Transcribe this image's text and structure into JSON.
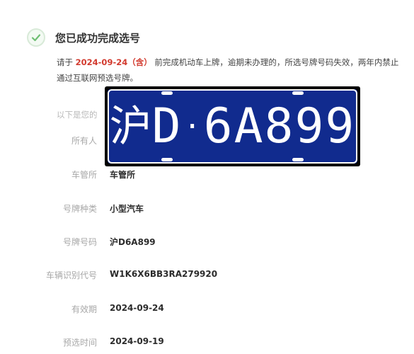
{
  "success": {
    "title": "您已成功完成选号",
    "check_color": "#6fbf73"
  },
  "notice": {
    "prefix": "请于",
    "deadline": "2024-09-24（含）",
    "suffix": "前完成机动车上牌，逾期未办理的，所选号牌号码失效，两年内禁止通过互联网预选号牌。"
  },
  "info_header": "以下是您的",
  "plate": {
    "province": "沪",
    "letter": "D",
    "dot": "·",
    "number": "6A899",
    "background_color": "#112b8e",
    "text_color": "#ffffff"
  },
  "fields": {
    "owner": {
      "label": "所有人",
      "value": ""
    },
    "office": {
      "label": "车管所",
      "value": "车管所"
    },
    "plate_type": {
      "label": "号牌种类",
      "value": "小型汽车"
    },
    "plate_number": {
      "label": "号牌号码",
      "value": "沪D6A899"
    },
    "vin": {
      "label": "车辆识别代号",
      "value": "W1K6X6BB3RA279920"
    },
    "valid_until": {
      "label": "有效期",
      "value": "2024-09-24"
    },
    "selection_time": {
      "label": "预选时间",
      "value": "2024-09-19"
    }
  },
  "colors": {
    "deadline_red": "#d23a2e",
    "label_gray": "#a8a8a8"
  }
}
